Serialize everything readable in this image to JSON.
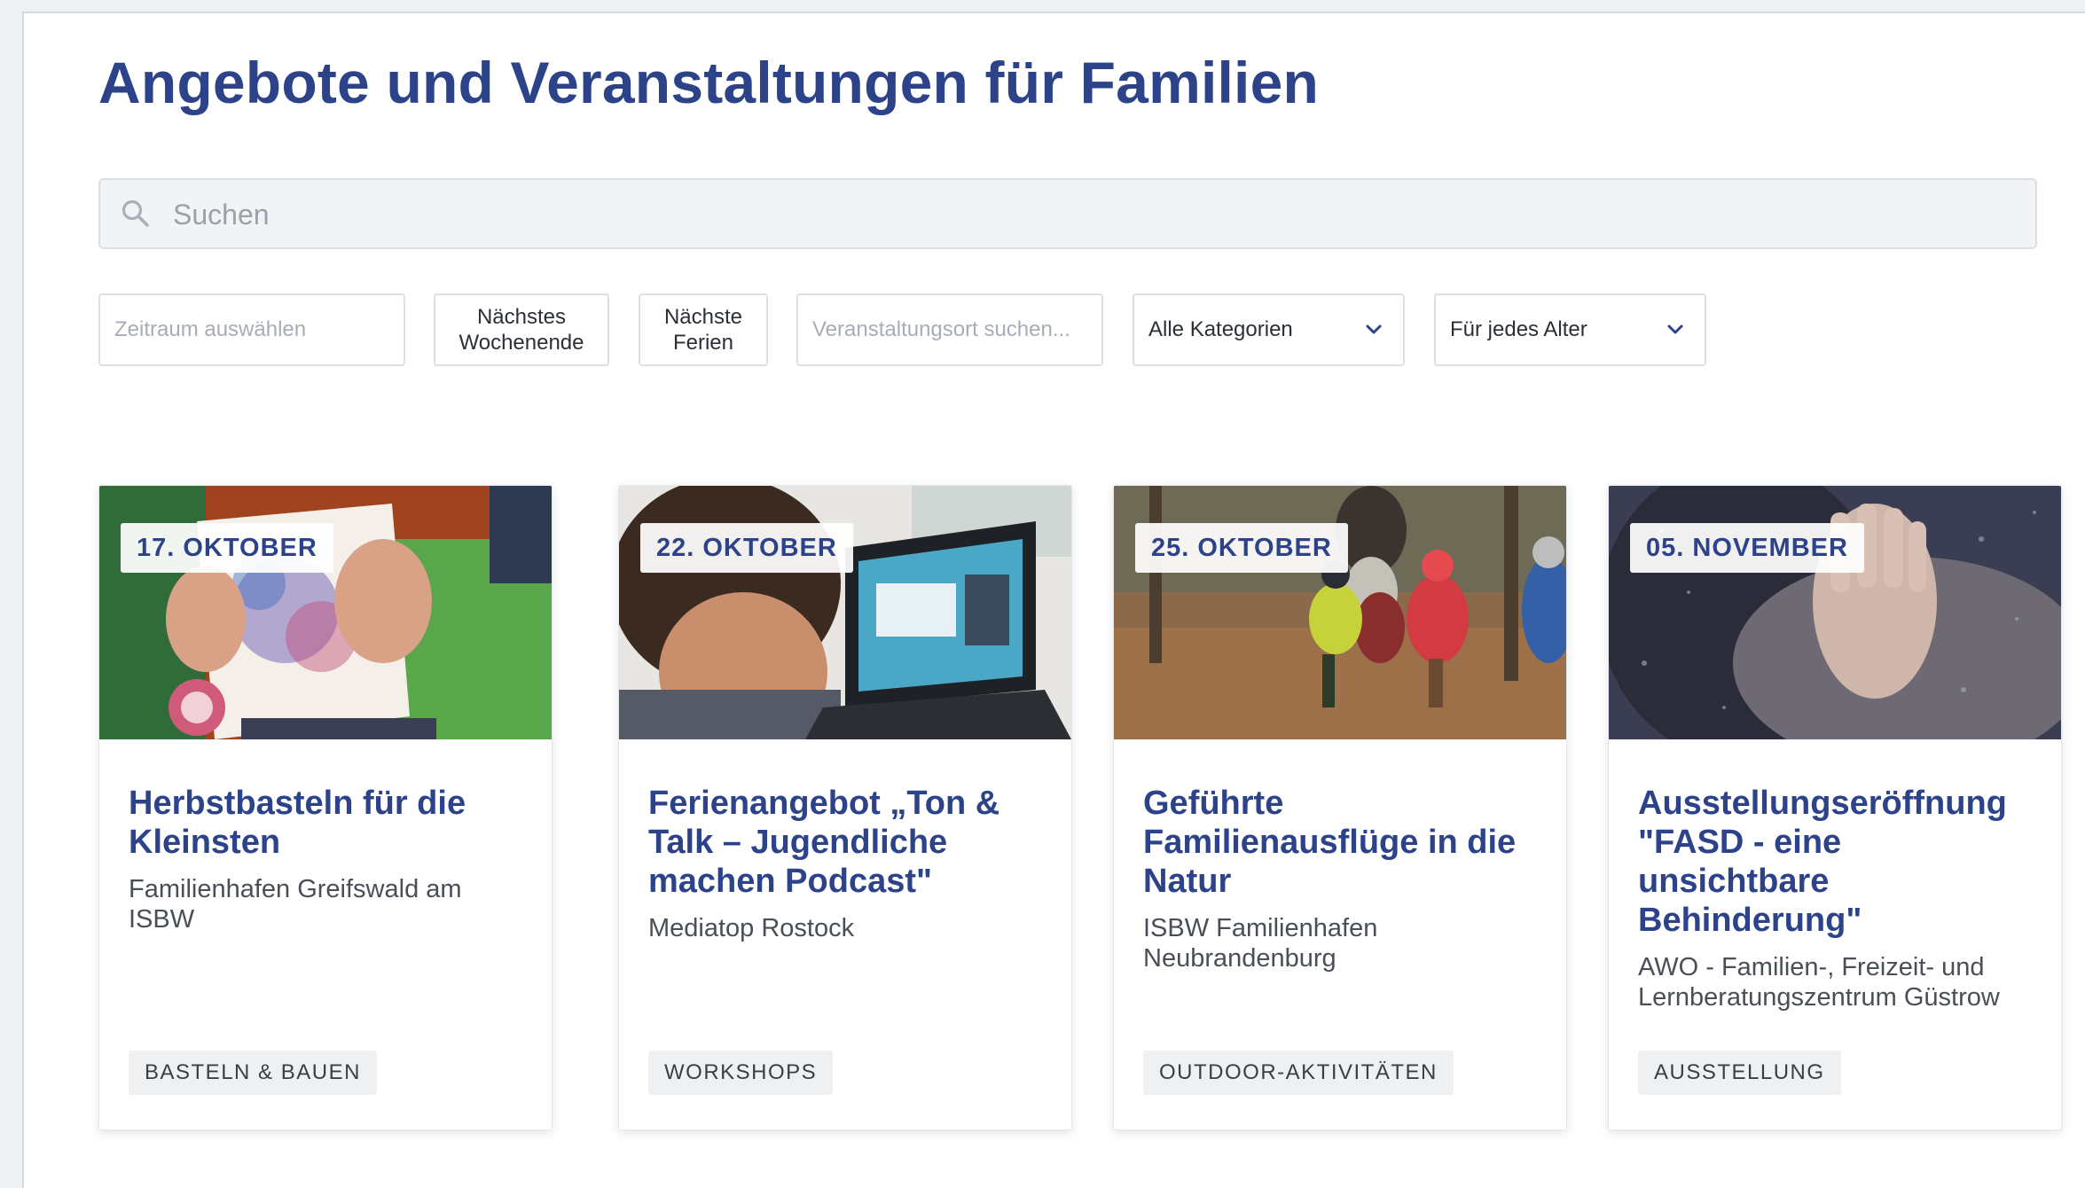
{
  "page": {
    "title": "Angebote und Veranstaltungen für Familien"
  },
  "search": {
    "placeholder": "Suchen"
  },
  "filters": {
    "date_range_placeholder": "Zeitraum auswählen",
    "next_weekend_label": "Nächstes\nWochenende",
    "next_holidays_label": "Nächste\nFerien",
    "location_placeholder": "Veranstaltungsort suchen...",
    "category_selected": "Alle Kategorien",
    "age_selected": "Für jedes Alter"
  },
  "colors": {
    "brand_blue": "#2d4389",
    "tag_background": "#eef0f2"
  },
  "events": [
    {
      "date": "17. OKTOBER",
      "title": "Herbstbasteln für die Kleinsten",
      "location": "Familienhafen Greifswald am ISBW",
      "tag": "BASTELN & BAUEN",
      "image": "children-painting-hands-photo"
    },
    {
      "date": "22. OKTOBER",
      "title": "Ferienangebot „Ton & Talk – Jugendliche machen Podcast\"",
      "location": "Mediatop Rostock",
      "tag": "WORKSHOPS",
      "image": "boy-at-laptop-photo"
    },
    {
      "date": "25. OKTOBER",
      "title": "Geführte Familienausflüge in die Natur",
      "location": "ISBW Familienhafen Neubrandenburg",
      "tag": "OUTDOOR-AKTIVITÄTEN",
      "image": "children-running-in-forest-photo"
    },
    {
      "date": "05. NOVEMBER",
      "title": "Ausstellungseröffnung \"FASD - eine unsichtbare Behinderung\"",
      "location": "AWO - Familien-, Freizeit- und Lernberatungszentrum Güstrow",
      "tag": "AUSSTELLUNG",
      "image": "hand-on-rainy-window-photo"
    }
  ]
}
